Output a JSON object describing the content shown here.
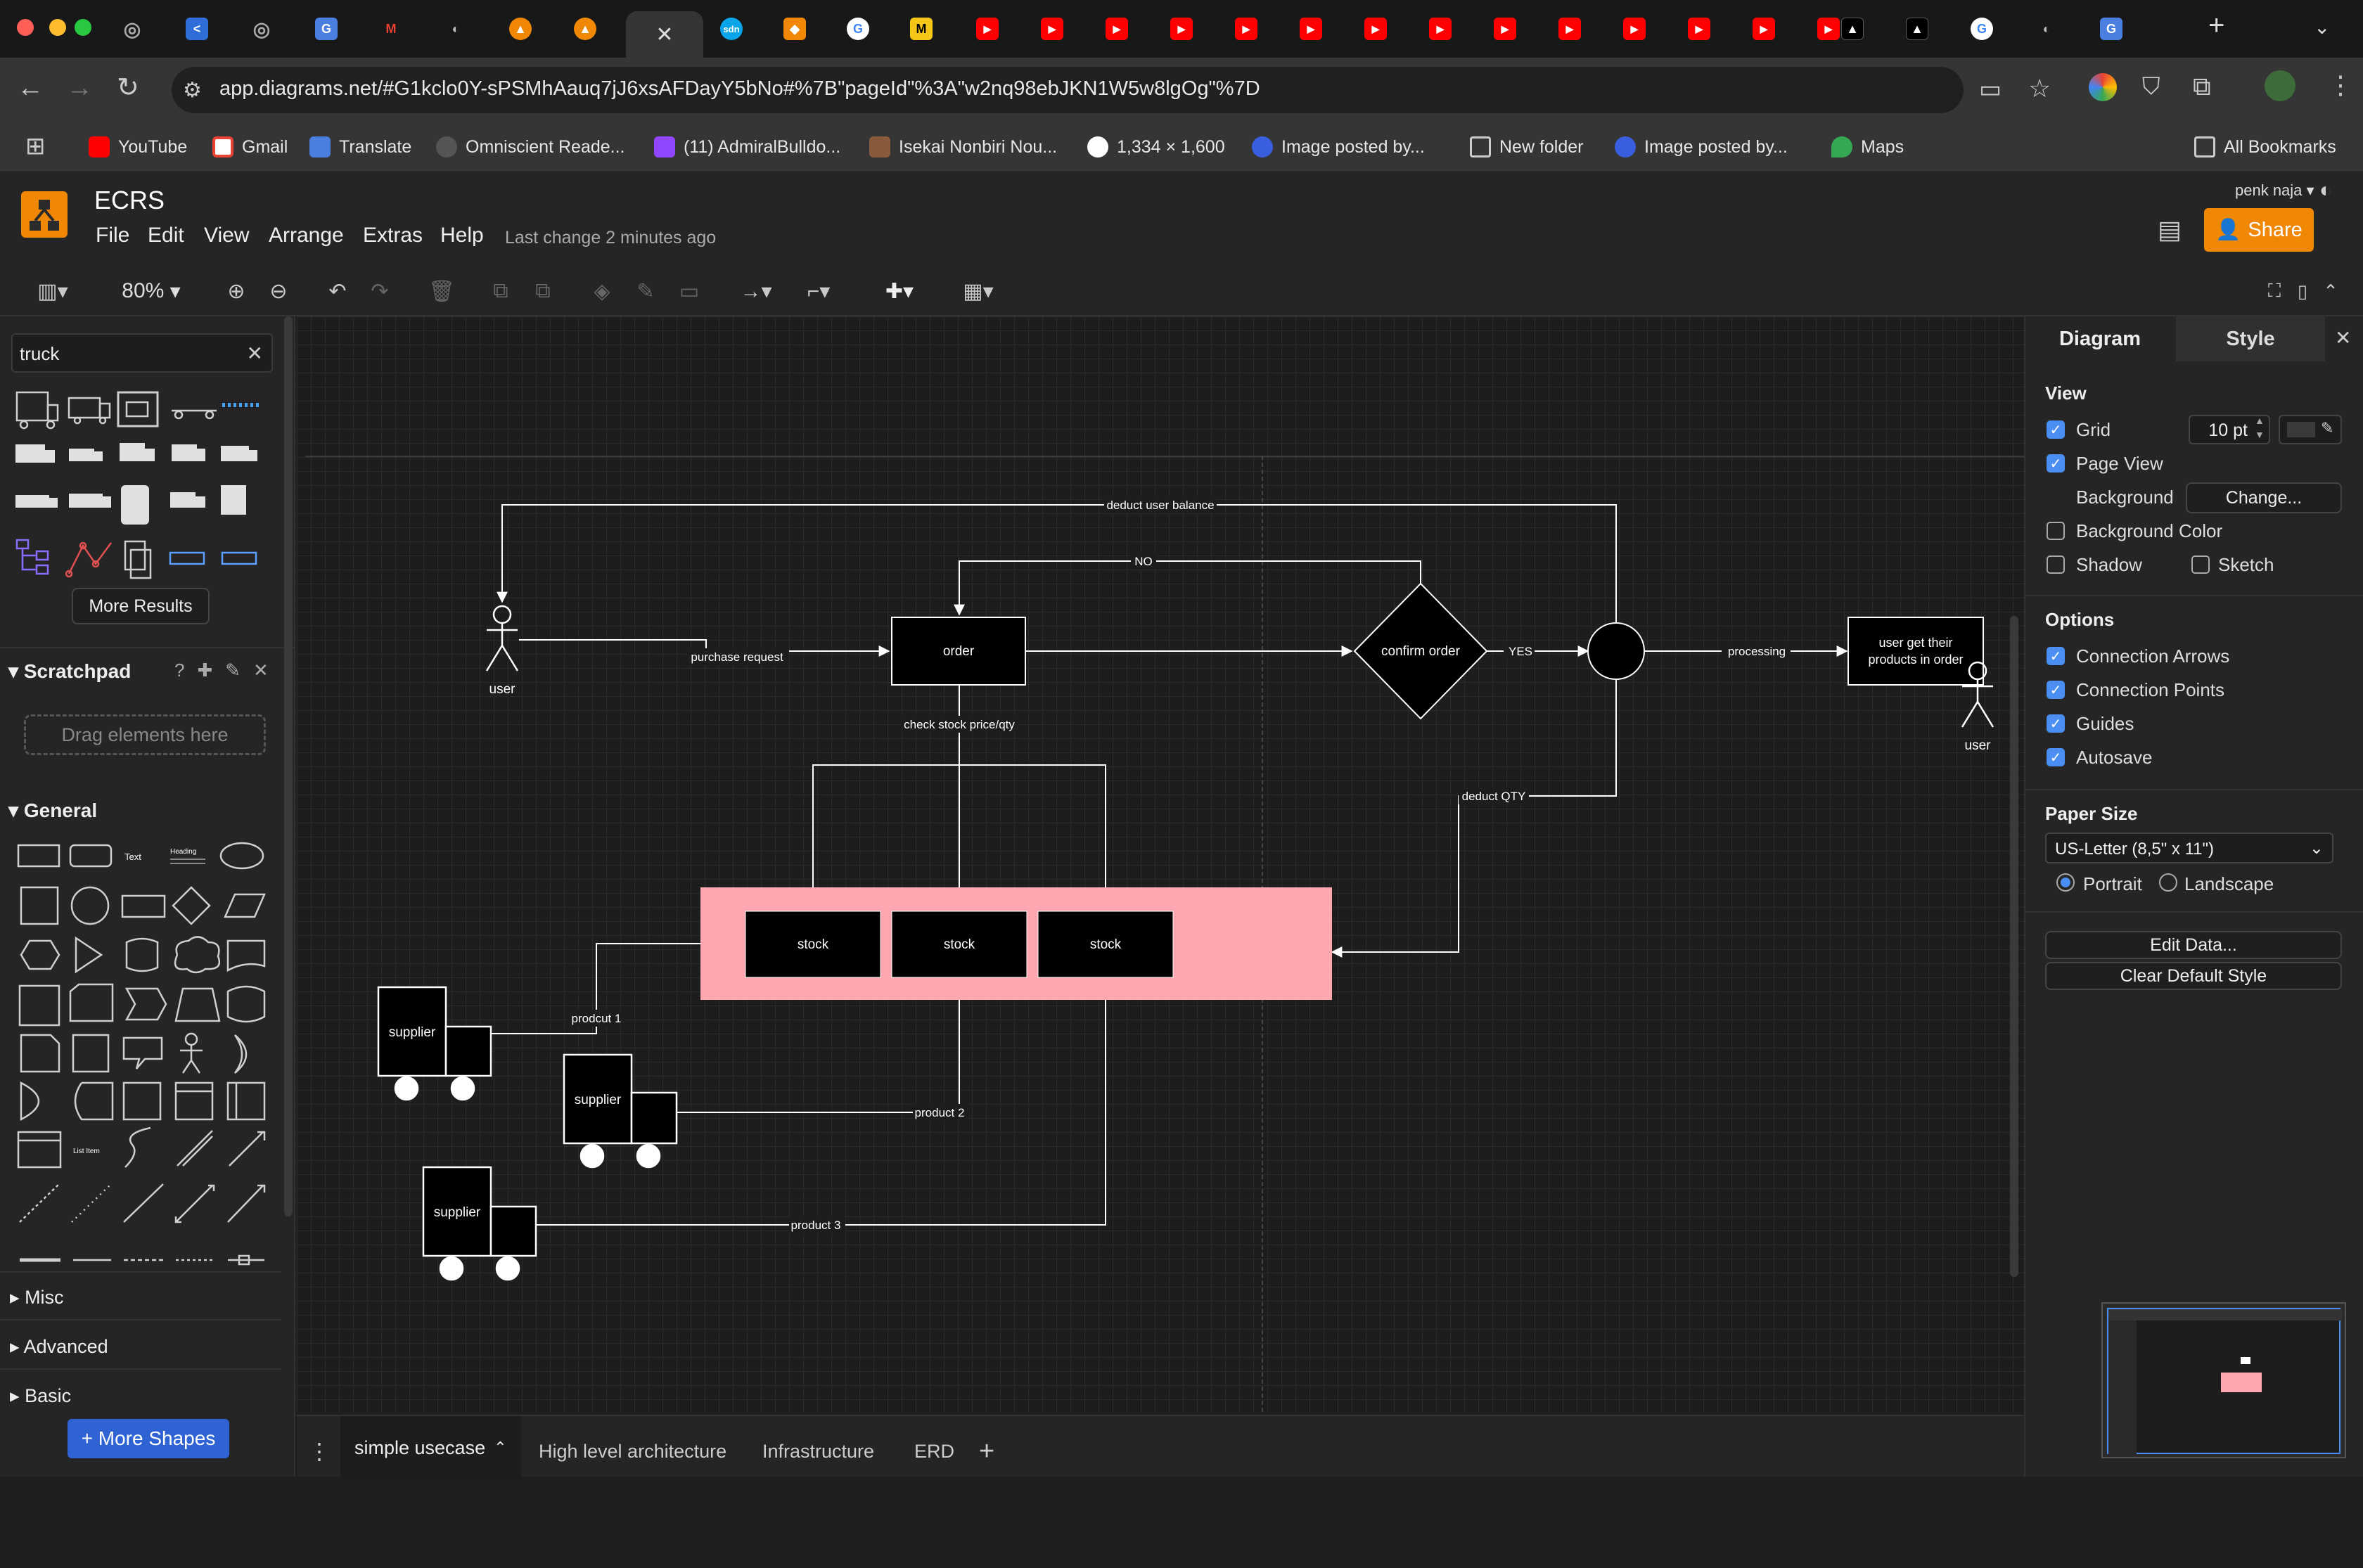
{
  "browser": {
    "url": "app.diagrams.net/#G1kclo0Y-sPSMhAauq7jJ6xsAFDayY5bNo#%7B\"pageId\"%3A\"w2nq98ebJKN1W5w8lgOg\"%7D",
    "bookmarks": [
      "YouTube",
      "Gmail",
      "Translate",
      "Omniscient Reade...",
      "(11) AdmiralBulldo...",
      "Isekai Nonbiri Nou...",
      "1,334 × 1,600",
      "Image posted by...",
      "New folder",
      "Image posted by...",
      "Maps"
    ],
    "all_bookmarks": "All Bookmarks",
    "new_tab": "+"
  },
  "app": {
    "title": "ECRS",
    "menu": [
      "File",
      "Edit",
      "View",
      "Arrange",
      "Extras",
      "Help"
    ],
    "last_change": "Last change 2 minutes ago",
    "user": "penk naja",
    "share_label": "Share",
    "zoom": "80%"
  },
  "sidebar": {
    "search_value": "truck",
    "more_results": "More Results",
    "scratchpad_title": "Scratchpad",
    "drag_hint": "Drag elements here",
    "general_title": "General",
    "sections": [
      "Misc",
      "Advanced",
      "Basic"
    ],
    "more_shapes": "+ More Shapes",
    "tiny_text": "Text",
    "tiny_heading": "Heading",
    "tiny_list": "List Item"
  },
  "format_panel": {
    "tabs": [
      "Diagram",
      "Style"
    ],
    "view_title": "View",
    "grid_label": "Grid",
    "grid_size": "10 pt",
    "page_view_label": "Page View",
    "background_label": "Background",
    "change_button": "Change...",
    "background_color_label": "Background Color",
    "shadow_label": "Shadow",
    "sketch_label": "Sketch",
    "options_title": "Options",
    "options": [
      "Connection Arrows",
      "Connection Points",
      "Guides",
      "Autosave"
    ],
    "paper_size_title": "Paper Size",
    "paper_size_value": "US-Letter (8,5\" x 11\")",
    "portrait": "Portrait",
    "landscape": "Landscape",
    "edit_data": "Edit Data...",
    "clear_default": "Clear Default Style"
  },
  "page_tabs": [
    "simple usecase",
    "High level architecture",
    "Infrastructure",
    "ERD"
  ],
  "diagram": {
    "user_left": "user",
    "user_right": "user",
    "order": "order",
    "confirm": "confirm order",
    "final_box": "user get their products in order",
    "final_box_line1": "user get their",
    "final_box_line2": "products in order",
    "stock": [
      "stock",
      "stock",
      "stock"
    ],
    "supplier": [
      "supplier",
      "supplier",
      "supplier"
    ],
    "edge_labels": {
      "deduct_balance": "deduct user balance",
      "no": "NO",
      "purchase": "purchase request",
      "yes": "YES",
      "processing": "processing",
      "check_stock": "check stock price/qty",
      "deduct_qty": "deduct QTY",
      "product1": "prodcut 1",
      "product2": "product 2",
      "product3": "product 3"
    },
    "colors": {
      "stock_container": "#ffa7b0",
      "stock_box": "#000000",
      "line": "#ffffff"
    }
  }
}
